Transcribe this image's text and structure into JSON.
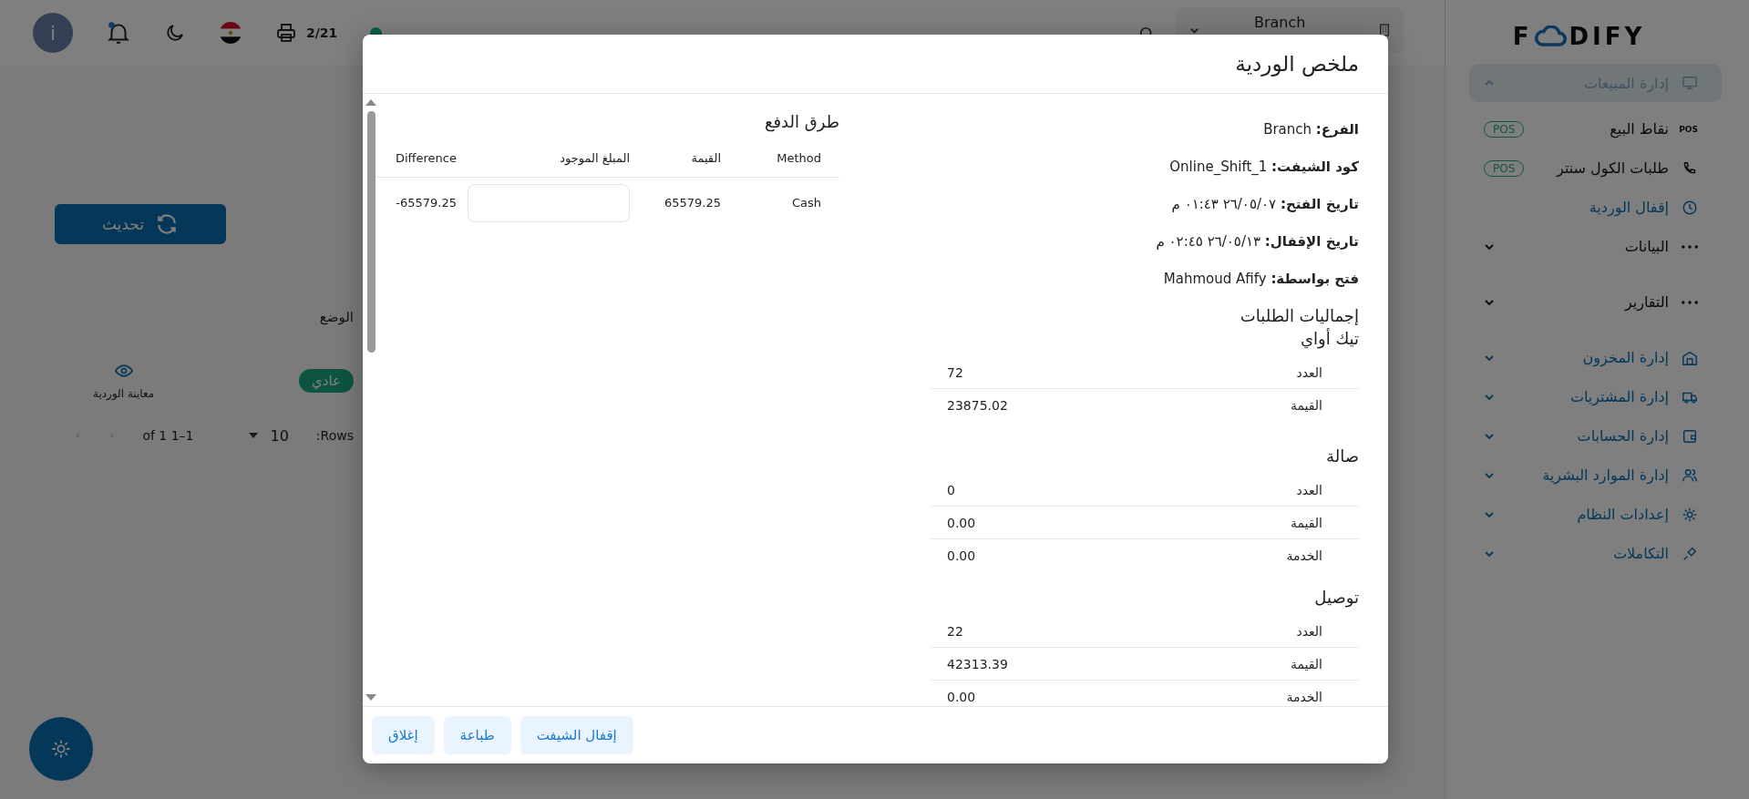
{
  "sidebar": {
    "logo": {
      "before": "F",
      "after": "DIFY"
    },
    "items": [
      {
        "kind": "module",
        "label": "إدارة المبيعات",
        "expanded": true,
        "children": [
          {
            "label": "نقاط البيع",
            "icon_text": "POS",
            "badge": "POS",
            "selected": false
          },
          {
            "label": "طلبات الكول سنتر",
            "badge": "POS",
            "selected": false
          },
          {
            "label": "إقفال الوردية",
            "selected": true
          }
        ]
      },
      {
        "kind": "section",
        "label": "البيانات",
        "expanded": false
      },
      {
        "kind": "section",
        "label": "التقارير",
        "expanded": false
      },
      {
        "kind": "module",
        "label": "إدارة المخزون",
        "expanded": false
      },
      {
        "kind": "module",
        "label": "إدارة المشتريات",
        "expanded": false
      },
      {
        "kind": "module",
        "label": "إدارة الحسابات",
        "expanded": false
      },
      {
        "kind": "module",
        "label": "إدارة الموارد البشرية",
        "expanded": false
      },
      {
        "kind": "module",
        "label": "إعدادات النظام",
        "expanded": false
      },
      {
        "kind": "module",
        "label": "التكاملات",
        "expanded": false
      }
    ]
  },
  "topbar": {
    "branch_select": {
      "value": "Branch"
    },
    "counter": "2/21",
    "avatar_letter": "i"
  },
  "page": {
    "refresh_button": "تحديث",
    "table": {
      "columns": [
        "الوضع"
      ],
      "rows": [
        {
          "status": "عادي",
          "action": "معاينة الوردية"
        }
      ]
    },
    "pagination": {
      "rows_label": ":Rows",
      "rows_per_page": "10",
      "range": "of 1 1–1"
    }
  },
  "modal": {
    "title": "ملخص الوردية",
    "info": [
      "**الفرع:** Branch",
      "**كود الشيفت:** Online_Shift_1",
      "**تاريخ الفتح:** ٢٦/٠٥/٠٧ ٠١:٤٣ م",
      "**تاريخ الإقفال:** ٢٦/٠٥/١٣ ٠٢:٤٥ م",
      "**فتح بواسطة:** Mahmoud Afify"
    ],
    "totals_title": "إجماليات الطلبات",
    "sections": [
      {
        "title": "تيك أواي",
        "rows": [
          {
            "label": "العدد",
            "value": "72"
          },
          {
            "label": "القيمة",
            "value": "23875.02"
          }
        ]
      },
      {
        "title": "صالة",
        "rows": [
          {
            "label": "العدد",
            "value": "0"
          },
          {
            "label": "القيمة",
            "value": "0.00"
          },
          {
            "label": "الخدمة",
            "value": "0.00"
          }
        ]
      },
      {
        "title": "توصيل",
        "rows": [
          {
            "label": "العدد",
            "value": "22"
          },
          {
            "label": "القيمة",
            "value": "42313.39"
          },
          {
            "label": "الخدمة",
            "value": "0.00"
          }
        ]
      }
    ],
    "payments": {
      "title": "طرق الدفع",
      "columns": [
        "Method",
        "القيمة",
        "المبلغ الموجود",
        "Difference"
      ],
      "rows": [
        {
          "method": "Cash",
          "amount": "65579.25",
          "difference": "-65579.25"
        }
      ]
    },
    "buttons": [
      "إقفال الشيفت",
      "طباعة",
      "إغلاق"
    ]
  }
}
